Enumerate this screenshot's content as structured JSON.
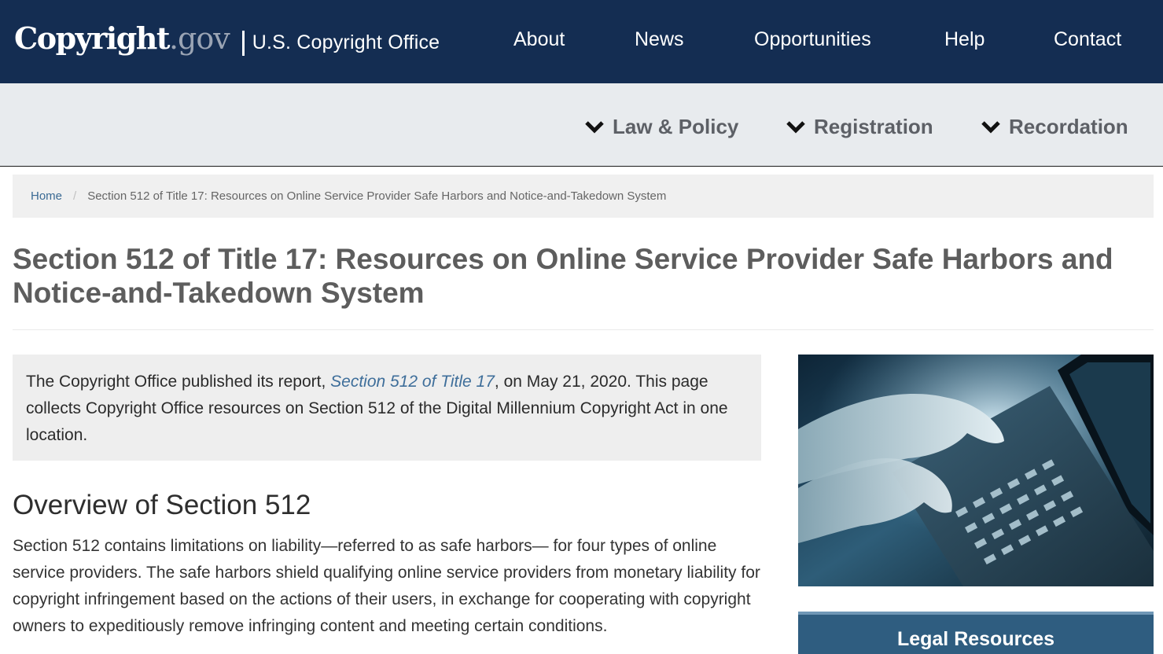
{
  "header": {
    "logo_word": "Copyright",
    "logo_tld": ".gov",
    "office_name": "U.S. Copyright Office",
    "nav": [
      {
        "label": "About"
      },
      {
        "label": "News"
      },
      {
        "label": "Opportunities"
      },
      {
        "label": "Help"
      },
      {
        "label": "Contact"
      }
    ]
  },
  "subnav": {
    "items": [
      {
        "label": "Law & Policy",
        "icon": "chevron-down-icon"
      },
      {
        "label": "Registration",
        "icon": "chevron-down-icon"
      },
      {
        "label": "Recordation",
        "icon": "chevron-down-icon"
      }
    ]
  },
  "breadcrumb": {
    "home": "Home",
    "separator": "/",
    "current": "Section 512 of Title 17: Resources on Online Service Provider Safe Harbors and Notice-and-Takedown System"
  },
  "page": {
    "title": "Section 512 of Title 17: Resources on Online Service Provider Safe Harbors and Notice-and-Takedown System"
  },
  "intro": {
    "text_before": "The Copyright Office published its report, ",
    "link": "Section 512 of Title 17",
    "text_after": ", on May 21, 2020. This page collects Copyright Office resources on Section 512 of the Digital Millennium Copyright Act in one location."
  },
  "overview": {
    "heading": "Overview of Section 512",
    "body": "Section 512 contains limitations on liability—referred to as safe harbors— for four types of online service providers. The safe harbors shield qualifying online service providers from monetary liability for copyright infringement based on the actions of their users, in exchange for cooperating with copyright owners to expeditiously remove infringing content and meeting certain conditions."
  },
  "sidebar": {
    "legal_title": "Legal Resources"
  },
  "colors": {
    "header_bg": "#142d52",
    "subnav_bg": "#e8ebee",
    "link": "#3e6e9a",
    "sidebar_title_bg": "#2f5d80"
  }
}
